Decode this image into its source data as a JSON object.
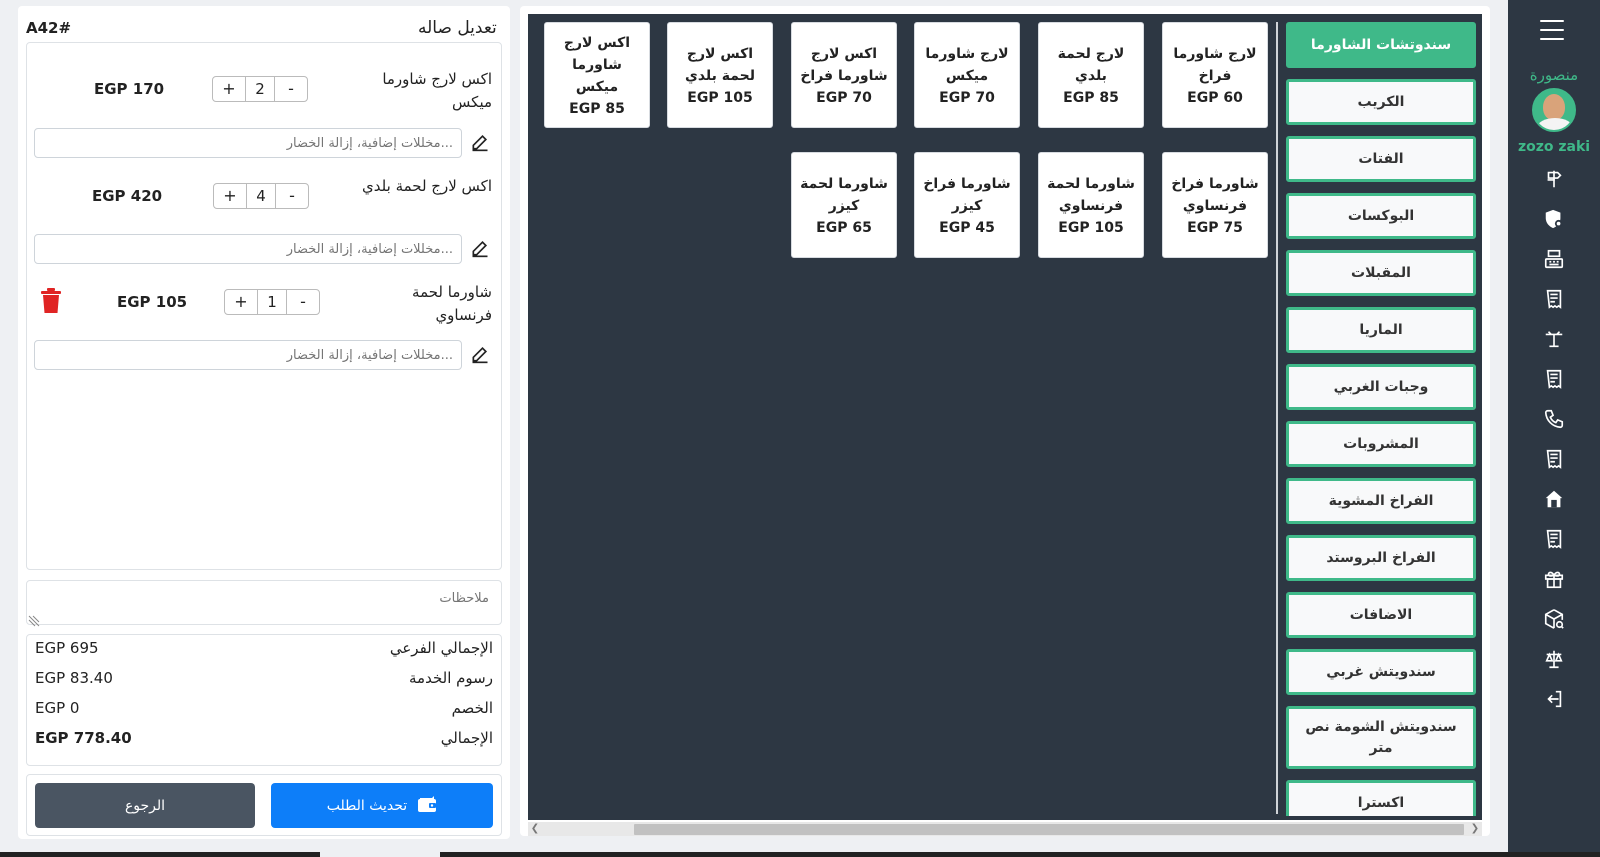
{
  "rail": {
    "brand": "منصورة",
    "username": "zozo zaki",
    "icons": [
      "menu-icon",
      "signpost-icon",
      "shield-gear-icon",
      "cash-register-icon",
      "receipt-icon",
      "table-icon",
      "receipt-icon",
      "phone-icon",
      "receipt-icon",
      "store-icon",
      "receipt-icon",
      "gift-icon",
      "package-search-icon",
      "scale-icon",
      "logout-icon"
    ]
  },
  "categories": [
    "سندوتشات الشاورما",
    "الكريب",
    "الفتات",
    "البوكسات",
    "المقبلات",
    "الماريا",
    "وجبات الغربي",
    "المشروبات",
    "الفراخ المشوية",
    "الفراخ البروستد",
    "الاضافات",
    "سندويتش غربي",
    "سندويتش الشومة نص متر",
    "اكسترا"
  ],
  "products": [
    {
      "name": "لارج شاورما فراخ",
      "price": "EGP 60"
    },
    {
      "name": "لارج لحمة بلدي",
      "price": "EGP 85"
    },
    {
      "name": "لارج شاورما ميكس",
      "price": "EGP 70"
    },
    {
      "name": "اكس لارج شاورما فراخ",
      "price": "EGP 70"
    },
    {
      "name": "اكس لارج لحمة بلدي",
      "price": "EGP 105"
    },
    {
      "name": "اكس لارج شاورما ميكس",
      "price": "EGP 85"
    },
    {
      "name": "شاورما فراخ فرنساوي",
      "price": "EGP 75"
    },
    {
      "name": "شاورما لحمة فرنساوي",
      "price": "EGP 105"
    },
    {
      "name": "شاورما فراخ كيزر",
      "price": "EGP 45"
    },
    {
      "name": "شاورما لحمة كيزر",
      "price": "EGP 65"
    }
  ],
  "order": {
    "title": "تعديل صاله",
    "id": "A42#",
    "extras_placeholder": "مخللات إضافية، إزالة الخضار...",
    "notes_placeholder": "ملاحظات",
    "items": [
      {
        "name": "اكس لارج شاورما ميكس",
        "qty": "2",
        "price": "EGP 170",
        "plus": "+",
        "minus": "-"
      },
      {
        "name": "اكس لارج لحمة بلدي",
        "qty": "4",
        "price": "EGP 420",
        "plus": "+",
        "minus": "-"
      },
      {
        "name": "شاورما لحمة فرنساوي",
        "qty": "1",
        "price": "EGP 105",
        "plus": "+",
        "minus": "-"
      }
    ],
    "totals": {
      "subtotal_label": "الإجمالي الفرعي",
      "subtotal": "EGP 695",
      "service_label": "رسوم الخدمة",
      "service": "EGP 83.40",
      "discount_label": "الخصم",
      "discount": "EGP 0",
      "total_label": "الإجمالي",
      "total": "EGP 778.40"
    },
    "update_label": "تحديث الطلب",
    "back_label": "الرجوع"
  },
  "colors": {
    "accent": "#3fb989",
    "dark": "#2d3743",
    "primary": "#0d7ef9",
    "danger": "#e02424"
  }
}
